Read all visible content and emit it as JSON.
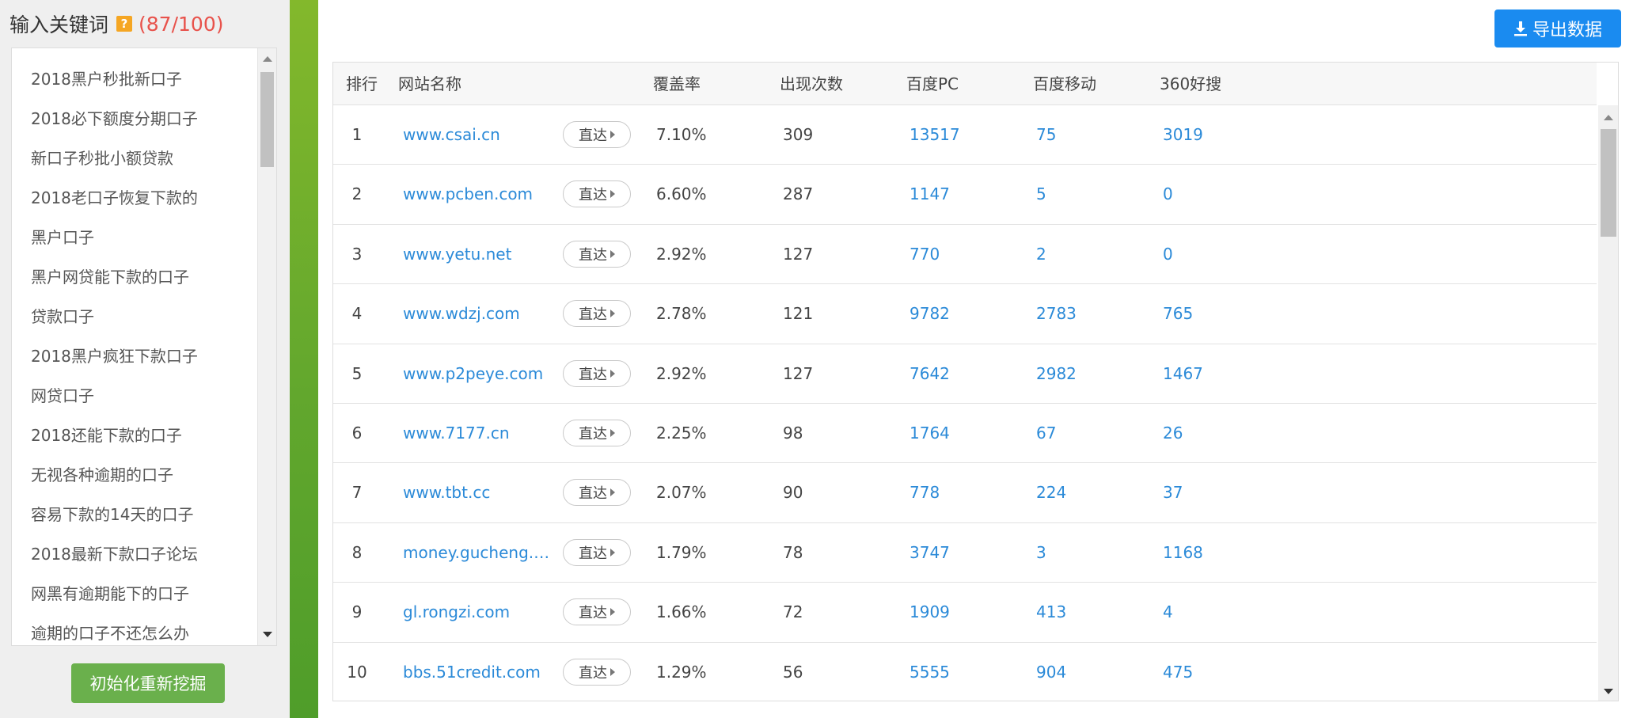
{
  "keyword_panel": {
    "title": "输入关键词",
    "help_icon": "?",
    "count": "(87/100)",
    "keywords": [
      "2018黑户秒批新口子",
      "2018必下额度分期口子",
      "新口子秒批小额贷款",
      "2018老口子恢复下款的",
      "黑户口子",
      "黑户网贷能下款的口子",
      "贷款口子",
      "2018黑户疯狂下款口子",
      "网贷口子",
      "2018还能下款的口子",
      "无视各种逾期的口子",
      "容易下款的14天的口子",
      "2018最新下款口子论坛",
      "网黑有逾期能下的口子",
      "逾期的口子不还怎么办"
    ],
    "reinit_label": "初始化重新挖掘"
  },
  "toolbar": {
    "export_label": "导出数据",
    "export_icon": "download-icon"
  },
  "table": {
    "headers": {
      "rank": "排行",
      "site": "网站名称",
      "coverage": "覆盖率",
      "count": "出现次数",
      "baidu_pc": "百度PC",
      "baidu_mobile": "百度移动",
      "so360": "360好搜"
    },
    "direct_label": "直达",
    "rows": [
      {
        "rank": "1",
        "site": "www.csai.cn",
        "coverage": "7.10%",
        "count": "309",
        "baidu_pc": "13517",
        "baidu_mobile": "75",
        "so360": "3019"
      },
      {
        "rank": "2",
        "site": "www.pcben.com",
        "coverage": "6.60%",
        "count": "287",
        "baidu_pc": "1147",
        "baidu_mobile": "5",
        "so360": "0"
      },
      {
        "rank": "3",
        "site": "www.yetu.net",
        "coverage": "2.92%",
        "count": "127",
        "baidu_pc": "770",
        "baidu_mobile": "2",
        "so360": "0"
      },
      {
        "rank": "4",
        "site": "www.wdzj.com",
        "coverage": "2.78%",
        "count": "121",
        "baidu_pc": "9782",
        "baidu_mobile": "2783",
        "so360": "765"
      },
      {
        "rank": "5",
        "site": "www.p2peye.com",
        "coverage": "2.92%",
        "count": "127",
        "baidu_pc": "7642",
        "baidu_mobile": "2982",
        "so360": "1467"
      },
      {
        "rank": "6",
        "site": "www.7177.cn",
        "coverage": "2.25%",
        "count": "98",
        "baidu_pc": "1764",
        "baidu_mobile": "67",
        "so360": "26"
      },
      {
        "rank": "7",
        "site": "www.tbt.cc",
        "coverage": "2.07%",
        "count": "90",
        "baidu_pc": "778",
        "baidu_mobile": "224",
        "so360": "37"
      },
      {
        "rank": "8",
        "site": "money.gucheng.c...",
        "coverage": "1.79%",
        "count": "78",
        "baidu_pc": "3747",
        "baidu_mobile": "3",
        "so360": "1168"
      },
      {
        "rank": "9",
        "site": "gl.rongzi.com",
        "coverage": "1.66%",
        "count": "72",
        "baidu_pc": "1909",
        "baidu_mobile": "413",
        "so360": "4"
      },
      {
        "rank": "10",
        "site": "bbs.51credit.com",
        "coverage": "1.29%",
        "count": "56",
        "baidu_pc": "5555",
        "baidu_mobile": "904",
        "so360": "475"
      }
    ]
  }
}
